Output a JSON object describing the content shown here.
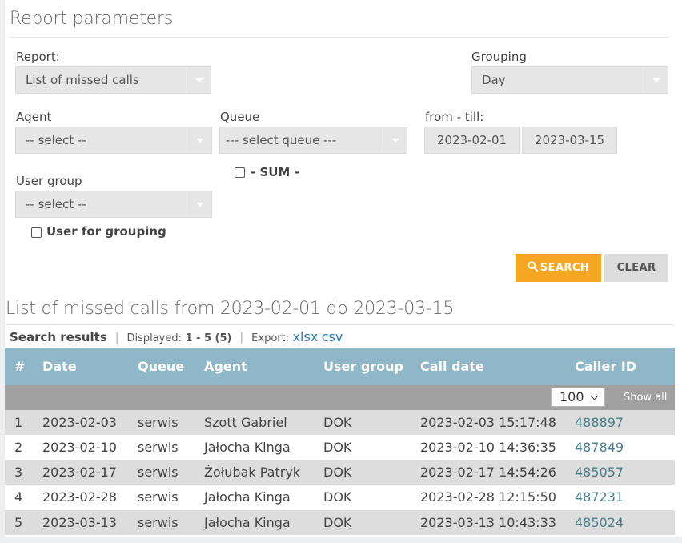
{
  "params": {
    "title": "Report parameters",
    "report_label": "Report:",
    "report_value": "List of missed calls",
    "grouping_label": "Grouping",
    "grouping_value": "Day",
    "agent_label": "Agent",
    "agent_value": "-- select --",
    "queue_label": "Queue",
    "queue_value": "--- select queue ---",
    "range_label": "from - till:",
    "date_from": "2023-02-01",
    "date_till": "2023-03-15",
    "sum_label": "- SUM -",
    "usergroup_label": "User group",
    "usergroup_value": "-- select --",
    "user_for_grouping_label": "User for grouping",
    "search_label": "SEARCH",
    "clear_label": "CLEAR"
  },
  "results": {
    "title": "List of missed calls from 2023-02-01 do 2023-03-15",
    "search_results_label": "Search results",
    "displayed_label": "Displayed:",
    "displayed_value": "1 - 5 (5)",
    "export_label": "Export:",
    "export_xlsx": "xlsx",
    "export_csv": "csv",
    "per_page": "100",
    "show_all": "Show all",
    "columns": [
      "#",
      "Date",
      "Queue",
      "Agent",
      "User group",
      "Call date",
      "Caller ID"
    ],
    "rows": [
      [
        "1",
        "2023-02-03",
        "serwis",
        "Szott Gabriel",
        "DOK",
        "2023-02-03 15:17:48",
        "488897"
      ],
      [
        "2",
        "2023-02-10",
        "serwis",
        "Jałocha Kinga",
        "DOK",
        "2023-02-10 14:36:35",
        "487849"
      ],
      [
        "3",
        "2023-02-17",
        "serwis",
        "Żołubak Patryk",
        "DOK",
        "2023-02-17 14:54:26",
        "485057"
      ],
      [
        "4",
        "2023-02-28",
        "serwis",
        "Jałocha Kinga",
        "DOK",
        "2023-02-28 12:15:50",
        "487231"
      ],
      [
        "5",
        "2023-03-13",
        "serwis",
        "Jałocha Kinga",
        "DOK",
        "2023-03-13 10:43:33",
        "485024"
      ]
    ]
  },
  "colors": {
    "accent": "#f5a623",
    "table_header": "#8fb7c7",
    "link": "#2a7fb8"
  }
}
